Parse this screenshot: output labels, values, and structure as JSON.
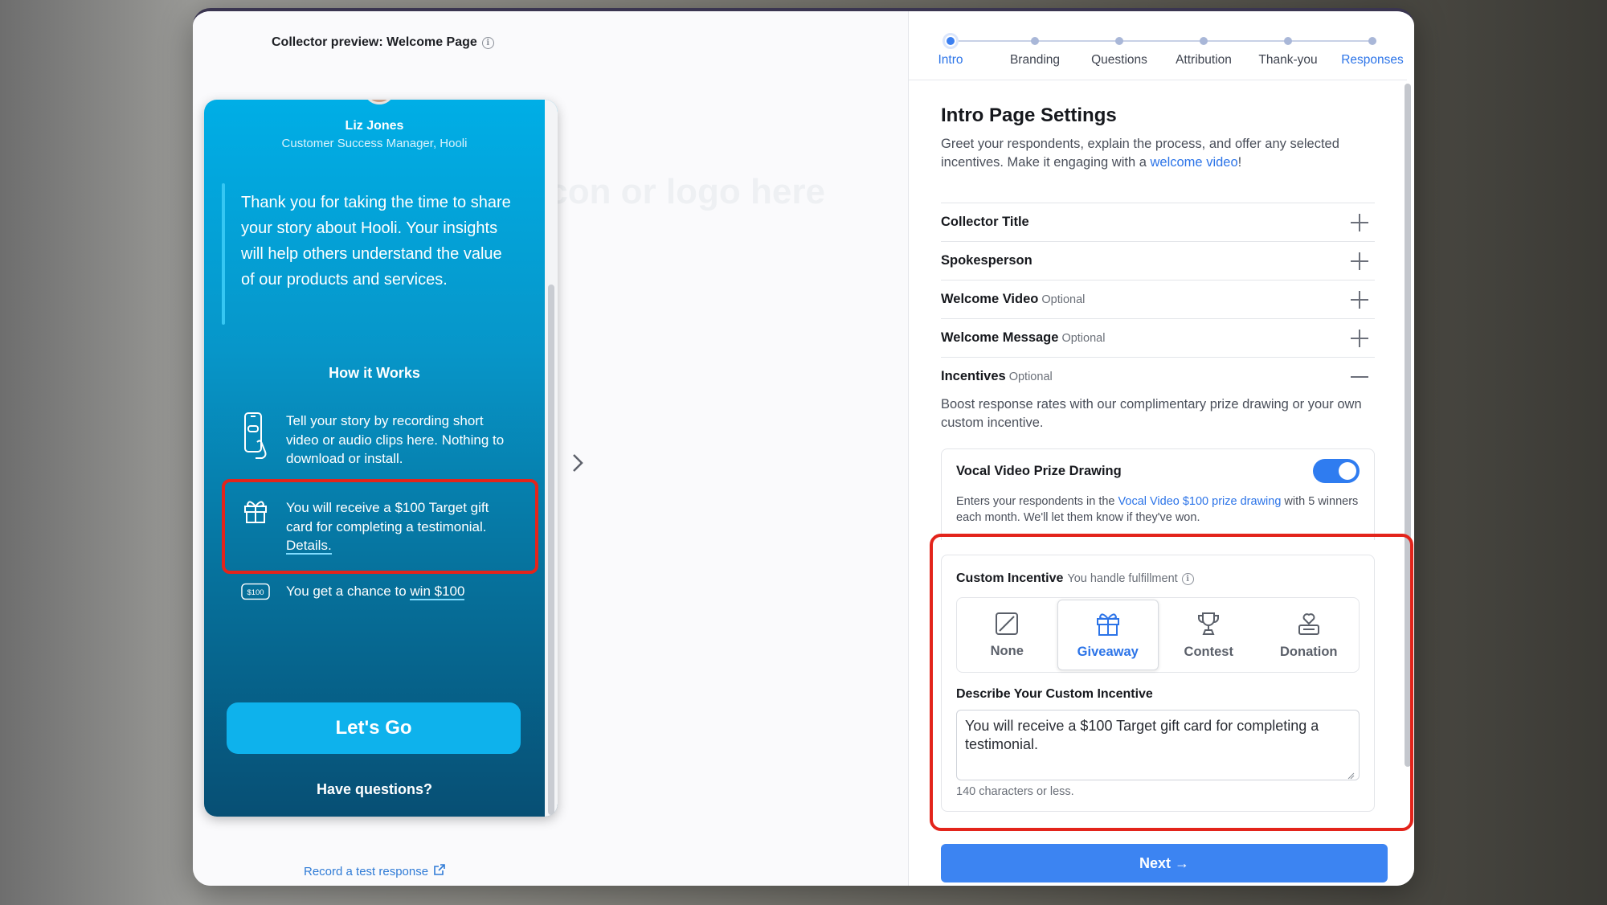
{
  "preview": {
    "title": "Collector preview: Welcome Page",
    "ghost_logo": "icon or logo here",
    "speaker_name": "Liz Jones",
    "speaker_role": "Customer Success Manager, Hooli",
    "welcome_message": "Thank you for taking the time to share your story about Hooli. Your insights will help others understand the value of our products and services.",
    "how_title": "How it Works",
    "steps": [
      {
        "text": "Tell your story by recording short video or audio clips here. Nothing to download or install."
      },
      {
        "text": "You will receive a $100 Target gift card for completing a testimonial.",
        "link": "Details."
      },
      {
        "text": "You get a chance to",
        "link": "win $100",
        "badge": "$100"
      }
    ],
    "go_button": "Let's Go",
    "questions_link": "Have questions?",
    "record_link": "Record a test response"
  },
  "stepper": {
    "steps": [
      "Intro",
      "Branding",
      "Questions",
      "Attribution",
      "Thank-you",
      "Responses"
    ],
    "active": "Intro"
  },
  "settings": {
    "title": "Intro Page Settings",
    "desc": "Greet your respondents, explain the process, and offer any selected incentives. Make it engaging with a",
    "desc_link": "welcome video",
    "desc_end": "!",
    "sections": [
      {
        "label": "Collector Title",
        "optional": "",
        "state": "collapsed"
      },
      {
        "label": "Spokesperson",
        "optional": "",
        "state": "collapsed"
      },
      {
        "label": "Welcome Video",
        "optional": "Optional",
        "state": "collapsed"
      },
      {
        "label": "Welcome Message",
        "optional": "Optional",
        "state": "collapsed"
      },
      {
        "label": "Incentives",
        "optional": "Optional",
        "state": "expanded"
      }
    ],
    "incentives_desc": "Boost response rates with our complimentary prize drawing or your own custom incentive.",
    "prize": {
      "title": "Vocal Video Prize Drawing",
      "enabled": true,
      "desc_before": "Enters your respondents in the",
      "desc_link": "Vocal Video $100 prize drawing",
      "desc_after": "with 5 winners each month. We'll let them know if they've won."
    },
    "custom": {
      "title": "Custom Incentive",
      "subtitle": "You handle fulfillment",
      "types": [
        "None",
        "Giveaway",
        "Contest",
        "Donation"
      ],
      "selected": "Giveaway",
      "describe_label": "Describe Your Custom Incentive",
      "describe_value": "You will receive a $100 Target gift card for completing a testimonial.",
      "char_note": "140 characters or less."
    },
    "next_button": "Next →"
  },
  "colors": {
    "accent": "#2c74e8",
    "highlight": "#e3241b",
    "phone_top": "#00aee6",
    "phone_bottom": "#074f74"
  }
}
